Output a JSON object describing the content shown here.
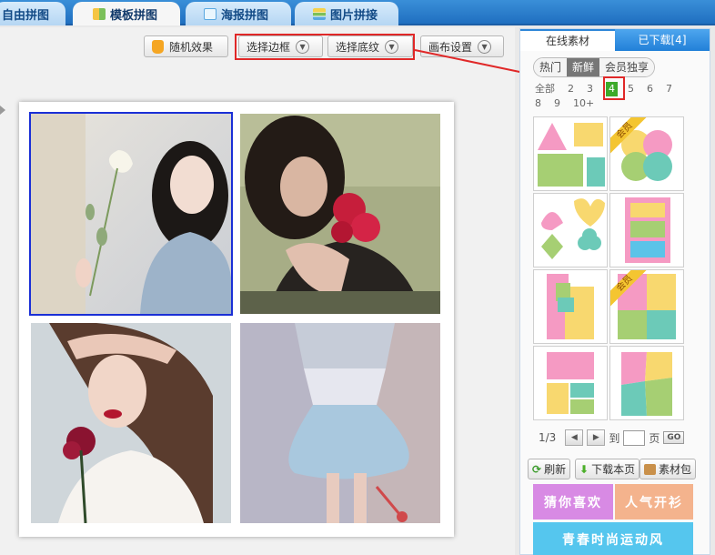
{
  "top_tabs": [
    {
      "label": "自由拼图",
      "icon": "free-collage-icon"
    },
    {
      "label": "模板拼图",
      "icon": "template-collage-icon"
    },
    {
      "label": "海报拼图",
      "icon": "poster-collage-icon"
    },
    {
      "label": "图片拼接",
      "icon": "image-stitch-icon"
    }
  ],
  "toolbar": {
    "random": "随机效果",
    "border": "选择边框",
    "texture": "选择底纹",
    "canvas": "画布设置"
  },
  "panel": {
    "tabs": [
      "在线素材",
      "已下载[4]"
    ],
    "filters": [
      "热门",
      "新鲜",
      "会员独享"
    ],
    "counts": [
      "全部",
      "2",
      "3",
      "4",
      "5",
      "6",
      "7",
      "8",
      "9",
      "10+"
    ],
    "selected_count": "4",
    "member_badge": "会员",
    "pager": {
      "page": "1/3",
      "goto": "到",
      "page_unit": "页",
      "go": "GO"
    },
    "actions": [
      "刷新",
      "下载本页",
      "素材包"
    ],
    "categories": [
      {
        "label": "猜你喜欢",
        "color": "#d88ae4"
      },
      {
        "label": "人气开衫",
        "color": "#f4b38d"
      },
      {
        "label": "青春时尚运动风",
        "color": "#55c6ee"
      }
    ]
  },
  "colors": {
    "pink": "#f59ac3",
    "yellow": "#f8d86f",
    "green": "#a6cf73",
    "teal": "#6ccab8",
    "blue": "#5cc3e8",
    "select_outline": "#1a2fd6",
    "annotation_red": "#e02828"
  }
}
